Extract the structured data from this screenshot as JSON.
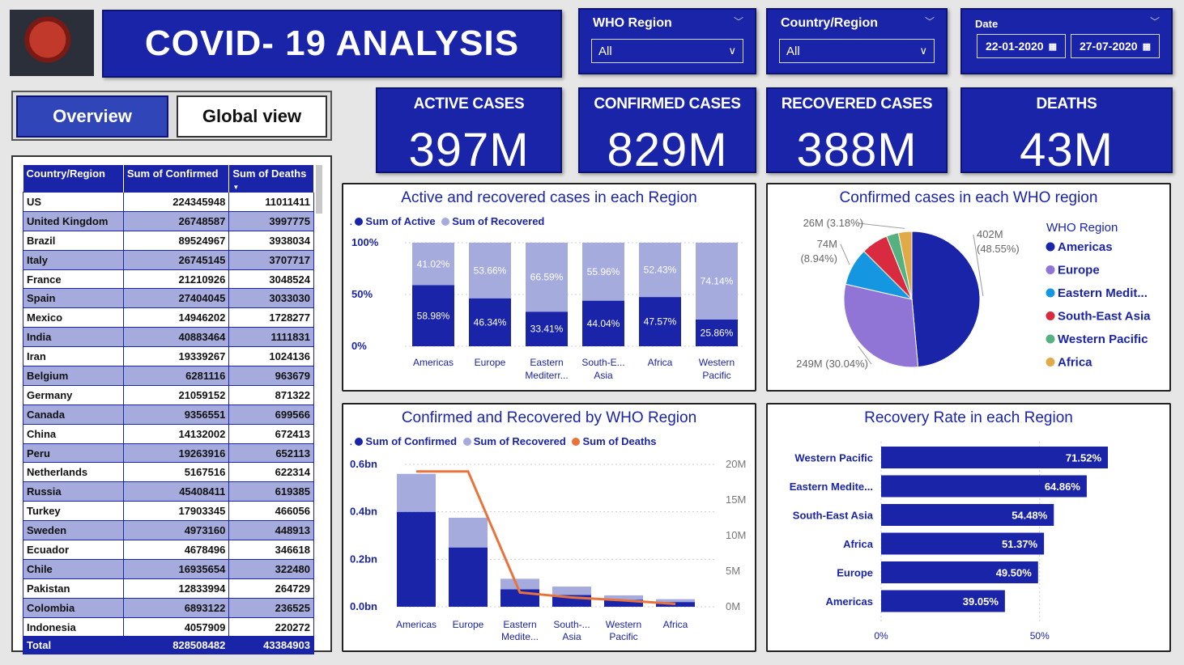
{
  "header": {
    "title": "COVID- 19  ANALYSIS"
  },
  "slicers": {
    "who_region": {
      "label": "WHO Region",
      "value": "All"
    },
    "country_region": {
      "label": "Country/Region",
      "value": "All"
    },
    "date": {
      "label": "Date",
      "from": "22-01-2020",
      "to": "27-07-2020"
    }
  },
  "tabs": {
    "overview": "Overview",
    "global": "Global view"
  },
  "kpis": [
    {
      "label": "ACTIVE CASES",
      "value": "397M"
    },
    {
      "label": "CONFIRMED CASES",
      "value": "829M"
    },
    {
      "label": "RECOVERED CASES",
      "value": "388M"
    },
    {
      "label": "DEATHS",
      "value": "43M"
    }
  ],
  "table": {
    "columns": [
      "Country/Region",
      "Sum of Confirmed",
      "Sum of Deaths"
    ],
    "rows": [
      [
        "US",
        "224345948",
        "11011411"
      ],
      [
        "United Kingdom",
        "26748587",
        "3997775"
      ],
      [
        "Brazil",
        "89524967",
        "3938034"
      ],
      [
        "Italy",
        "26745145",
        "3707717"
      ],
      [
        "France",
        "21210926",
        "3048524"
      ],
      [
        "Spain",
        "27404045",
        "3033030"
      ],
      [
        "Mexico",
        "14946202",
        "1728277"
      ],
      [
        "India",
        "40883464",
        "1111831"
      ],
      [
        "Iran",
        "19339267",
        "1024136"
      ],
      [
        "Belgium",
        "6281116",
        "963679"
      ],
      [
        "Germany",
        "21059152",
        "871322"
      ],
      [
        "Canada",
        "9356551",
        "699566"
      ],
      [
        "China",
        "14132002",
        "672413"
      ],
      [
        "Peru",
        "19263916",
        "652113"
      ],
      [
        "Netherlands",
        "5167516",
        "622314"
      ],
      [
        "Russia",
        "45408411",
        "619385"
      ],
      [
        "Turkey",
        "17903345",
        "466056"
      ],
      [
        "Sweden",
        "4973160",
        "448913"
      ],
      [
        "Ecuador",
        "4678496",
        "346618"
      ],
      [
        "Chile",
        "16935654",
        "322480"
      ],
      [
        "Pakistan",
        "12833994",
        "264729"
      ],
      [
        "Colombia",
        "6893122",
        "236525"
      ],
      [
        "Indonesia",
        "4057909",
        "220272"
      ]
    ],
    "total": [
      "Total",
      "828508482",
      "43384903"
    ]
  },
  "colors": {
    "navy": "#1a24a8",
    "light": "#a6abdd",
    "orange": "#e8743b"
  },
  "chart_data": [
    {
      "type": "bar",
      "title": "Active and recovered cases in each Region",
      "stacked_percent": true,
      "categories": [
        "Americas",
        "Europe",
        "Eastern Mediterr...",
        "South-E... Asia",
        "Africa",
        "Western Pacific"
      ],
      "series": [
        {
          "name": "Sum of Active",
          "values": [
            58.98,
            46.34,
            33.41,
            44.04,
            47.57,
            25.86
          ]
        },
        {
          "name": "Sum of Recovered",
          "values": [
            41.02,
            53.66,
            66.59,
            55.96,
            52.43,
            74.14
          ]
        }
      ],
      "y_ticks": [
        "100%",
        "50%",
        "0%"
      ]
    },
    {
      "type": "pie",
      "title": "Confirmed cases in each WHO region",
      "legend_title": "WHO Region",
      "slices": [
        {
          "name": "Americas",
          "value": 48.55,
          "label": "402M",
          "pct": "(48.55%)",
          "color": "#1a24a8"
        },
        {
          "name": "Europe",
          "value": 30.04,
          "label": "249M",
          "pct": "(30.04%)",
          "color": "#9074d6"
        },
        {
          "name": "Eastern Medit...",
          "value": 8.94,
          "label": "74M",
          "pct": "(8.94%)",
          "color": "#1496e0"
        },
        {
          "name": "South-East Asia",
          "value": 6.38,
          "label": "",
          "pct": "",
          "color": "#d92b3f"
        },
        {
          "name": "Western Pacific",
          "value": 2.91,
          "label": "",
          "pct": "",
          "color": "#55b280"
        },
        {
          "name": "Africa",
          "value": 3.18,
          "label": "26M",
          "pct": "(3.18%)",
          "color": "#e0aa48"
        }
      ]
    },
    {
      "type": "bar",
      "title": "Confirmed and Recovered by WHO Region",
      "categories": [
        "Americas",
        "Europe",
        "Eastern Medite...",
        "South-... Asia",
        "Western Pacific",
        "Africa"
      ],
      "series": [
        {
          "name": "Sum of Confirmed",
          "values": [
            0.4,
            0.25,
            0.074,
            0.05,
            0.03,
            0.02
          ]
        },
        {
          "name": "Sum of Recovered",
          "values": [
            0.16,
            0.125,
            0.044,
            0.035,
            0.018,
            0.012
          ]
        },
        {
          "name": "Sum of Deaths",
          "values": [
            19.0,
            19.0,
            2.0,
            1.3,
            0.9,
            0.4
          ]
        }
      ],
      "y_ticks": [
        "0.6bn",
        "0.4bn",
        "0.2bn",
        "0.0bn"
      ],
      "y2_ticks": [
        "20M",
        "15M",
        "10M",
        "5M",
        "0M"
      ],
      "ylim": [
        0,
        0.6
      ],
      "y2lim": [
        0,
        20
      ]
    },
    {
      "type": "bar",
      "orientation": "horizontal",
      "title": "Recovery Rate in each Region",
      "categories": [
        "Western Pacific",
        "Eastern Medite...",
        "South-East Asia",
        "Africa",
        "Europe",
        "Americas"
      ],
      "values": [
        71.52,
        64.86,
        54.48,
        51.37,
        49.5,
        39.05
      ],
      "labels": [
        "71.52%",
        "64.86%",
        "54.48%",
        "51.37%",
        "49.50%",
        "39.05%"
      ],
      "x_ticks": [
        "0%",
        "50%"
      ]
    }
  ]
}
